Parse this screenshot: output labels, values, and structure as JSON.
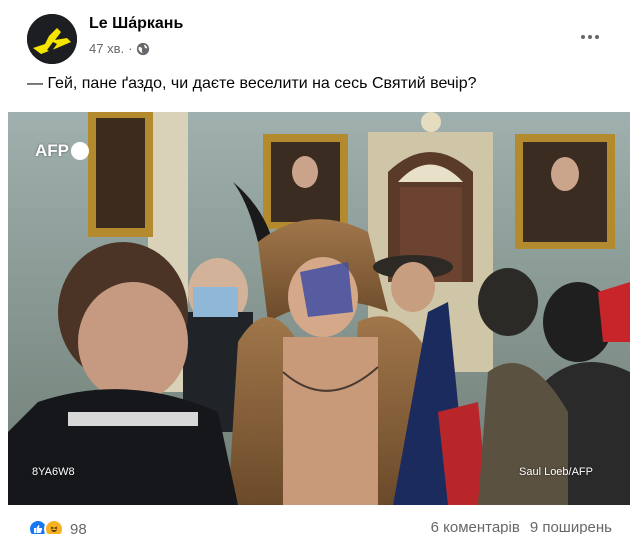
{
  "post": {
    "page_name": "Le Ша́ркань",
    "time": "47 хв.",
    "separator": "·",
    "text": "— Гей, пане ґаздо, чи даєте веселити на сесь Святий вечір?"
  },
  "photo": {
    "watermark": "AFP",
    "code": "8YA6W8",
    "credit": "Saul Loeb/AFP"
  },
  "footer": {
    "reaction_count": "98",
    "comments": "6 коментарів",
    "shares": "9 поширень"
  },
  "icons": {
    "avatar": "shark-logo-icon",
    "privacy": "globe-icon",
    "more": "more-options-icon",
    "like": "like-icon",
    "haha": "haha-icon"
  },
  "colors": {
    "text": "#050505",
    "secondary": "#65676b",
    "like_blue": "#1877f2",
    "haha_yellow": "#f7b125",
    "avatar_bg": "#1c1e21",
    "avatar_logo": "#f5e400"
  }
}
